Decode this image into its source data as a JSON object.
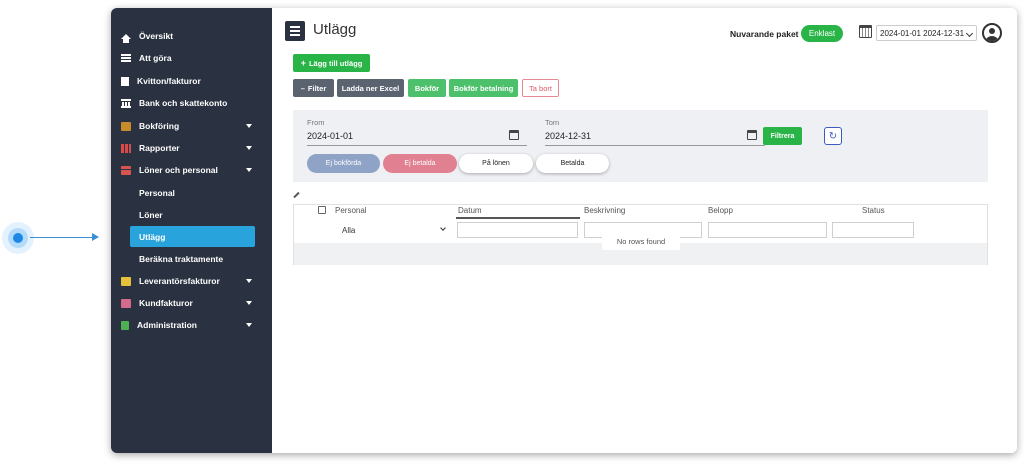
{
  "sidebar": {
    "items": [
      {
        "label": "Översikt",
        "icon": "home-icon"
      },
      {
        "label": "Att göra",
        "icon": "list-icon"
      },
      {
        "label": "Kvitton/fakturor",
        "icon": "document-icon"
      },
      {
        "label": "Bank och skattekonto",
        "icon": "bank-icon"
      },
      {
        "label": "Bokföring",
        "icon": "book-icon"
      },
      {
        "label": "Rapporter",
        "icon": "chart-icon"
      },
      {
        "label": "Löner och personal",
        "icon": "card-icon"
      },
      {
        "label": "Leverantörsfakturor",
        "icon": "supplier-icon"
      },
      {
        "label": "Kundfakturor",
        "icon": "customer-icon"
      },
      {
        "label": "Administration",
        "icon": "admin-icon"
      }
    ],
    "subitems": [
      "Personal",
      "Löner",
      "Utlägg",
      "Beräkna traktamente"
    ]
  },
  "header": {
    "title": "Utlägg",
    "package_label": "Nuvarande paket",
    "package_badge": "Enklast",
    "period": "2024-01-01 2024-12-31"
  },
  "toolbar": {
    "add_label": "Lägg till utlägg",
    "filter_label": "Filter",
    "excel_label": "Ladda ner Excel",
    "bokfor_label": "Bokför",
    "bokfor_betalning_label": "Bokför betalning",
    "tabort_label": "Ta bort"
  },
  "filters": {
    "from_label": "From",
    "from_value": "2024-01-01",
    "tom_label": "Tom",
    "tom_value": "2024-12-31",
    "filtrera_label": "Filtrera",
    "status_pills": [
      "Ej bokförda",
      "Ej betalda",
      "På lönen",
      "Betalda"
    ]
  },
  "grid": {
    "columns": [
      "Personal",
      "Datum",
      "Beskrivning",
      "Belopp",
      "Status"
    ],
    "personal_filter": "Alla",
    "empty_text": "No rows found"
  },
  "colors": {
    "sidebar_bg": "#2a3140",
    "active": "#29a3db",
    "green": "#28b446",
    "gray_button": "#5b6370"
  }
}
